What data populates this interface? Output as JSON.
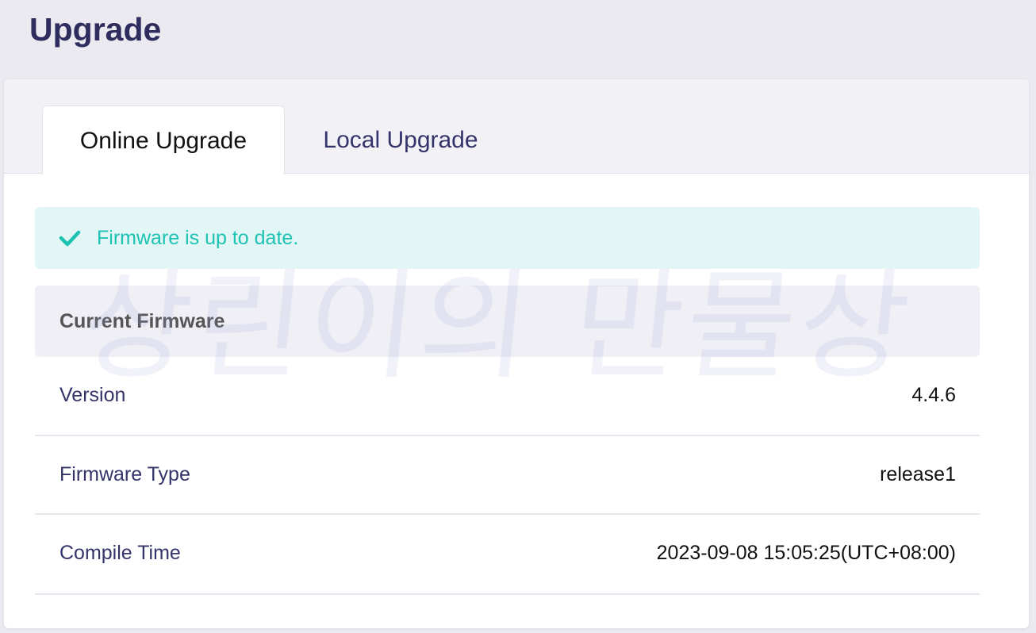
{
  "page": {
    "title": "Upgrade"
  },
  "tabs": [
    {
      "label": "Online Upgrade",
      "active": true
    },
    {
      "label": "Local Upgrade",
      "active": false
    }
  ],
  "status": {
    "icon": "check-icon",
    "message": "Firmware is up to date.",
    "color": "#1cc2b2"
  },
  "firmware": {
    "section_title": "Current Firmware",
    "rows": [
      {
        "label": "Version",
        "value": "4.4.6"
      },
      {
        "label": "Firmware Type",
        "value": "release1"
      },
      {
        "label": "Compile Time",
        "value": "2023-09-08 15:05:25(UTC+08:00)"
      }
    ]
  },
  "watermark": {
    "text": "상린이의 만물상"
  },
  "colors": {
    "accent": "#2e2d5e",
    "background": "#ebeaf0",
    "success_bg": "#e3f6f6"
  }
}
